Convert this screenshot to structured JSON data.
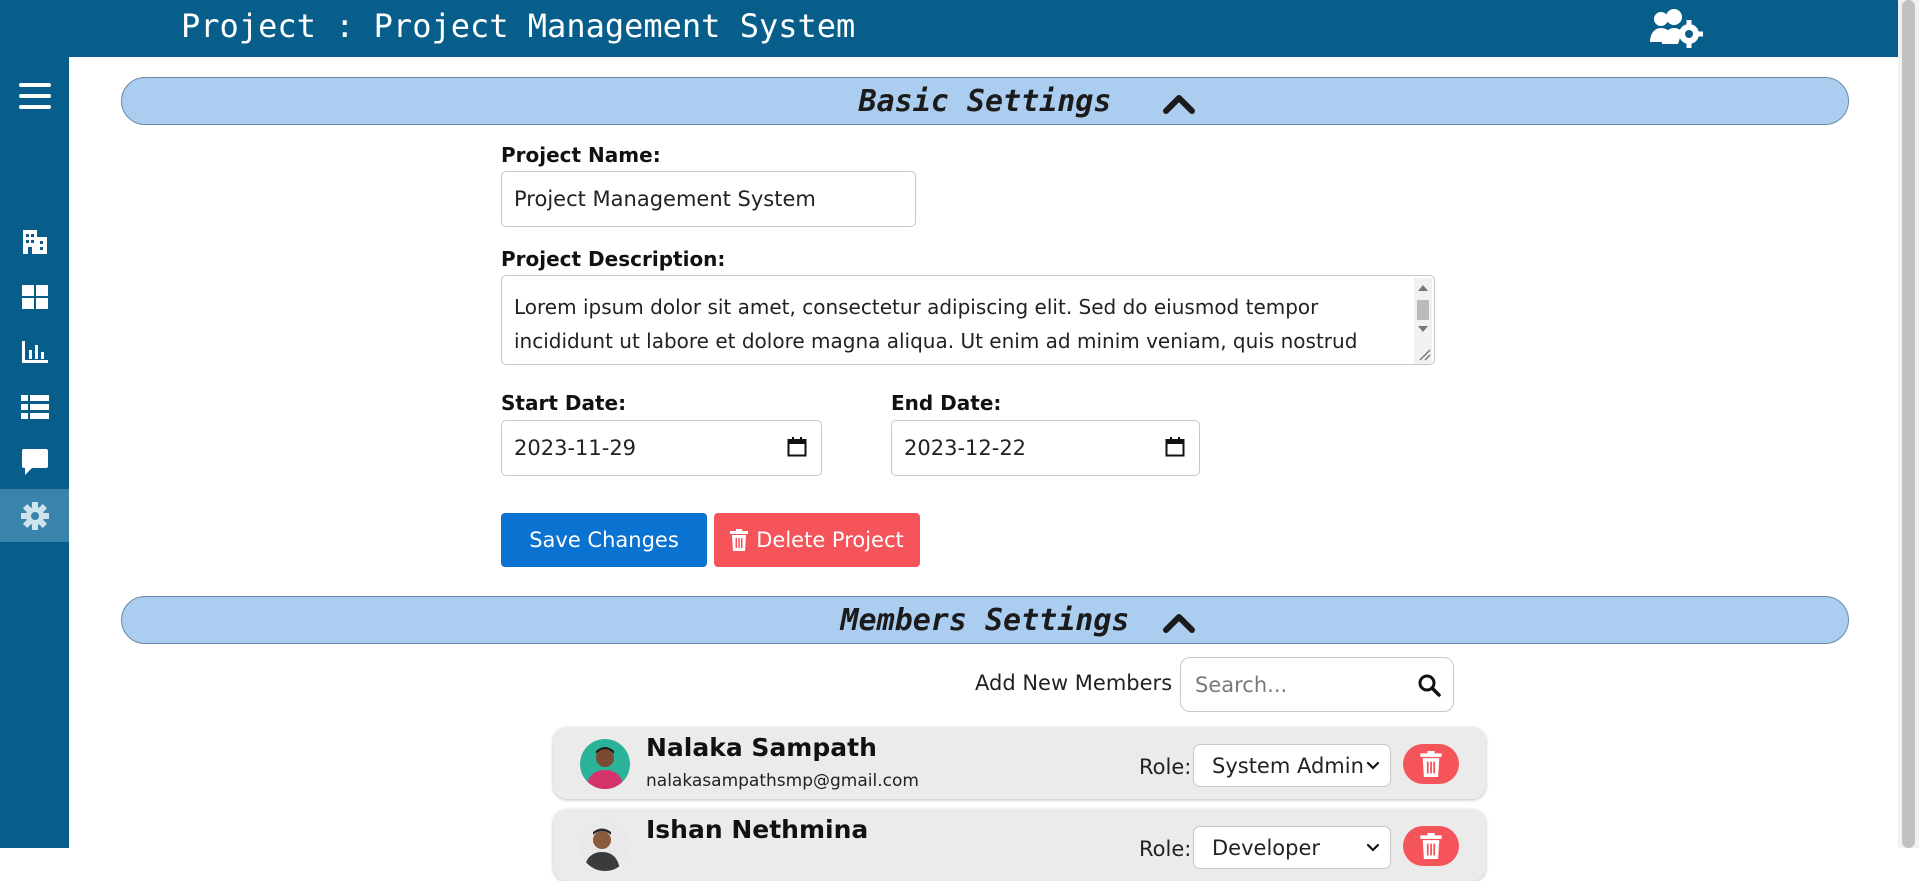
{
  "header": {
    "title": "Project : Project Management System",
    "settings_icon": "users-gear-icon"
  },
  "sidebar": {
    "items": [
      {
        "icon": "hamburger-menu-icon"
      },
      {
        "icon": "building-icon"
      },
      {
        "icon": "dashboard-grid-icon"
      },
      {
        "icon": "bar-chart-icon"
      },
      {
        "icon": "table-list-icon"
      },
      {
        "icon": "chat-icon"
      },
      {
        "icon": "gear-icon",
        "active": true
      }
    ]
  },
  "basic_settings": {
    "title": "Basic Settings",
    "project_name_label": "Project Name:",
    "project_name_value": "Project Management System",
    "description_label": "Project Description:",
    "description_value": "Lorem ipsum dolor sit amet, consectetur adipiscing elit. Sed do eiusmod tempor incididunt ut labore et dolore magna aliqua. Ut enim ad minim veniam, quis nostrud exercitation ullamco laboris nisi ut aliquip ex ea commodo consequat.",
    "start_date_label": "Start Date:",
    "start_date_value": "2023-11-29",
    "end_date_label": "End Date:",
    "end_date_value": "2023-12-22",
    "save_button": "Save Changes",
    "delete_button": "Delete Project"
  },
  "members_settings": {
    "title": "Members Settings",
    "add_label": "Add New Members :",
    "search_placeholder": "Search...",
    "role_label": "Role:",
    "members": [
      {
        "name": "Nalaka Sampath",
        "email": "nalakasampathsmp@gmail.com",
        "role": "System Admin"
      },
      {
        "name": "Ishan Nethmina",
        "email": "",
        "role": "Developer"
      }
    ]
  },
  "colors": {
    "primary": "#075e8a",
    "section_bar": "#aacdf0",
    "save": "#0a72d0",
    "danger": "#f4545a"
  }
}
